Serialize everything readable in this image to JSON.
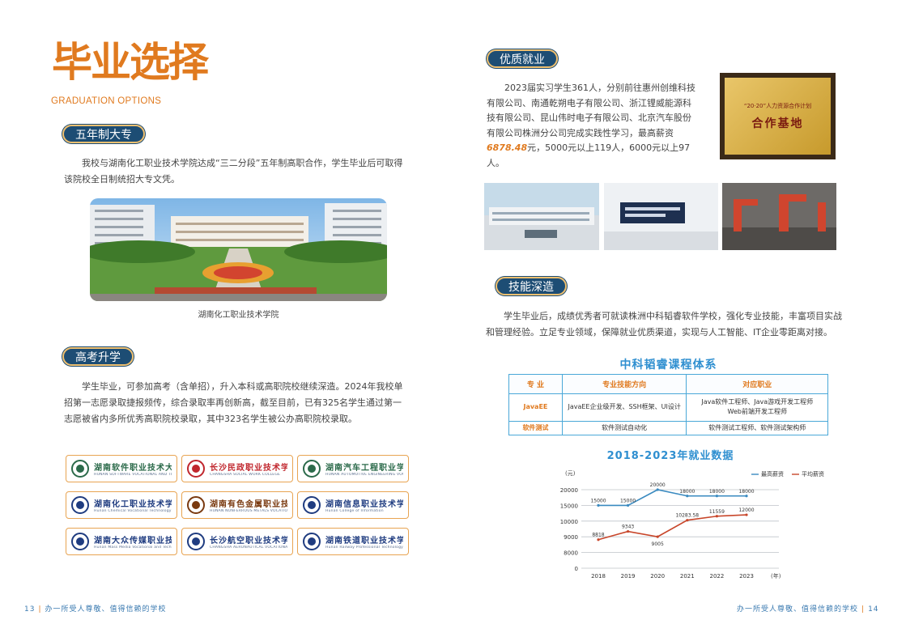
{
  "left": {
    "title": "毕业选择",
    "title_en": "GRADUATION OPTIONS",
    "sec1": {
      "label": "五年制大专",
      "text": "我校与湖南化工职业技术学院达成“三二分段”五年制高职合作，学生毕业后可取得该院校全日制统招大专文凭。",
      "photo_caption": "湖南化工职业技术学院"
    },
    "sec2": {
      "label": "高考升学",
      "text": "学生毕业，可参加高考（含单招），升入本科或高职院校继续深造。2024年我校单招第一志愿录取捷报频传，综合录取率再创新高，截至目前，已有325名学生通过第一志愿被省内多所优秀高职院校录取，其中323名学生被公办高职院校录取。"
    },
    "logos": [
      {
        "name": "湖南软件职业技术大学",
        "sub": "HUNAN SOFTWARE VOCATIONAL AND TECHNICAL UNIVERSITY",
        "color": "#2b6a4a"
      },
      {
        "name": "长沙民政职业技术学院",
        "sub": "CHANGSHA SOCIAL WORK COLLEGE",
        "color": "#c0262d"
      },
      {
        "name": "湖南汽车工程职业学院",
        "sub": "HUNAN AUTOMOTIVE ENGINEERING VOCATIONAL COLLEGE",
        "color": "#2b6a4a"
      },
      {
        "name": "湖南化工职业技术学院",
        "sub": "Hunan Chemical Vocational Technology College",
        "color": "#1f3c80"
      },
      {
        "name": "湖南有色金属职业技术学院",
        "sub": "HUNAN NONFERROUS METALS VOCATIONAL AND TECHNICAL COLLEGE",
        "color": "#7a3a10"
      },
      {
        "name": "湖南信息职业技术学院",
        "sub": "Hunan College of Information",
        "color": "#1f3c80"
      },
      {
        "name": "湖南大众传媒职业技术学院",
        "sub": "Hunan Mass Media Vocational and Technical College",
        "color": "#1f3c80"
      },
      {
        "name": "长沙航空职业技术学院",
        "sub": "CHANGSHA AERONAUTICAL VOCATIONAL AND TECHNICAL COLLEGE",
        "color": "#1f3c80"
      },
      {
        "name": "湖南铁道职业技术学院",
        "sub": "Hunan Railway Professional Technology College",
        "color": "#1f3c80"
      }
    ],
    "footer_page": "13",
    "footer_text": "办一所受人尊敬、值得信赖的学校"
  },
  "right": {
    "sec1": {
      "label": "优质就业",
      "text_a": "2023届实习学生361人，分别前往惠州创维科技有限公司、南通乾朔电子有限公司、浙江锂威能源科技有限公司、昆山伟时电子有限公司、北京汽车股份有限公司株洲分公司完成实践性学习，最高薪资",
      "salary": "6878.48",
      "text_b": "元，5000元以上119人，6000元以上97人。",
      "plaque_top": "“20·20”人力资源合作计划",
      "plaque_main": "合作基地"
    },
    "sec2": {
      "label": "技能深造",
      "text": "学生毕业后，成绩优秀者可就读株洲中科韬睿软件学校，强化专业技能，丰富项目实战和管理经验。立足专业领域，保障就业优质渠道，实现与人工智能、IT企业零距离对接。",
      "table_title": "中科韬睿课程体系",
      "table_headers": [
        "专  业",
        "专业技能方向",
        "对应职业"
      ],
      "table_rows": [
        [
          "JavaEE",
          "JavaEE企业级开发、SSH框架、UI设计",
          "Java软件工程师、Java游戏开发工程师\nWeb前端开发工程师"
        ],
        [
          "软件测试",
          "软件测试自动化",
          "软件测试工程师、软件测试架构师"
        ]
      ]
    },
    "footer_page": "14",
    "footer_text": "办一所受人尊敬、值得信赖的学校"
  },
  "colors": {
    "navy": "#1d4d74",
    "orange": "#e07a1f",
    "blue_line": "#3a8ac0",
    "red_line": "#c8462a"
  },
  "chart_data": {
    "type": "line",
    "title": "2018-2023年就业数据",
    "ylabel": "(元)",
    "xlabel": "(年)",
    "x": [
      "2018",
      "2019",
      "2020",
      "2021",
      "2022",
      "2023"
    ],
    "yticks": [
      0,
      8000,
      9000,
      10000,
      15000,
      20000
    ],
    "ytick_labels": [
      "0",
      "8000",
      "9000",
      "10000",
      "15000",
      "20000"
    ],
    "series": [
      {
        "name": "最高薪资",
        "values": [
          15000,
          15000,
          20000,
          18000,
          18000,
          18000
        ],
        "labels": [
          "15000",
          "15000",
          "20000",
          "18000",
          "18000",
          "18000"
        ],
        "color": "#3a8ac0"
      },
      {
        "name": "平均薪资",
        "values": [
          8818,
          9343,
          9005,
          10283.58,
          11559,
          12000
        ],
        "labels": [
          "8818",
          "9343",
          "9005",
          "10283.58",
          "11559",
          "12000"
        ],
        "color": "#c8462a"
      }
    ],
    "legend": "top-right",
    "grid": true
  }
}
